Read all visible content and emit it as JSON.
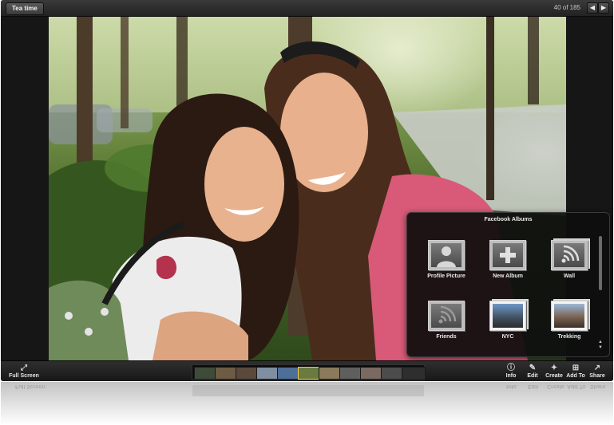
{
  "window": {
    "title": "Tea time",
    "counter": "40 of 185",
    "prev_icon": "chevron-left-icon",
    "next_icon": "chevron-right-icon"
  },
  "popup": {
    "title": "Facebook Albums",
    "albums": [
      {
        "label": "Profile Picture",
        "icon": "person-silhouette-icon"
      },
      {
        "label": "New Album",
        "icon": "plus-icon"
      },
      {
        "label": "Wall",
        "icon": "rss-icon"
      },
      {
        "label": "Friends",
        "icon": "rss-icon"
      },
      {
        "label": "NYC",
        "icon": "photo-stack-icon"
      },
      {
        "label": "Trekking",
        "icon": "photo-stack-icon"
      }
    ]
  },
  "toolbar": {
    "full_screen": "Full Screen",
    "info": "Info",
    "edit": "Edit",
    "create": "Create",
    "add_to": "Add To",
    "share": "Share"
  },
  "filmstrip": {
    "frame_count": 11,
    "selected_index": 5
  },
  "colors": {
    "accent_selected": "#f3c94a",
    "chrome_dark": "#161616"
  }
}
